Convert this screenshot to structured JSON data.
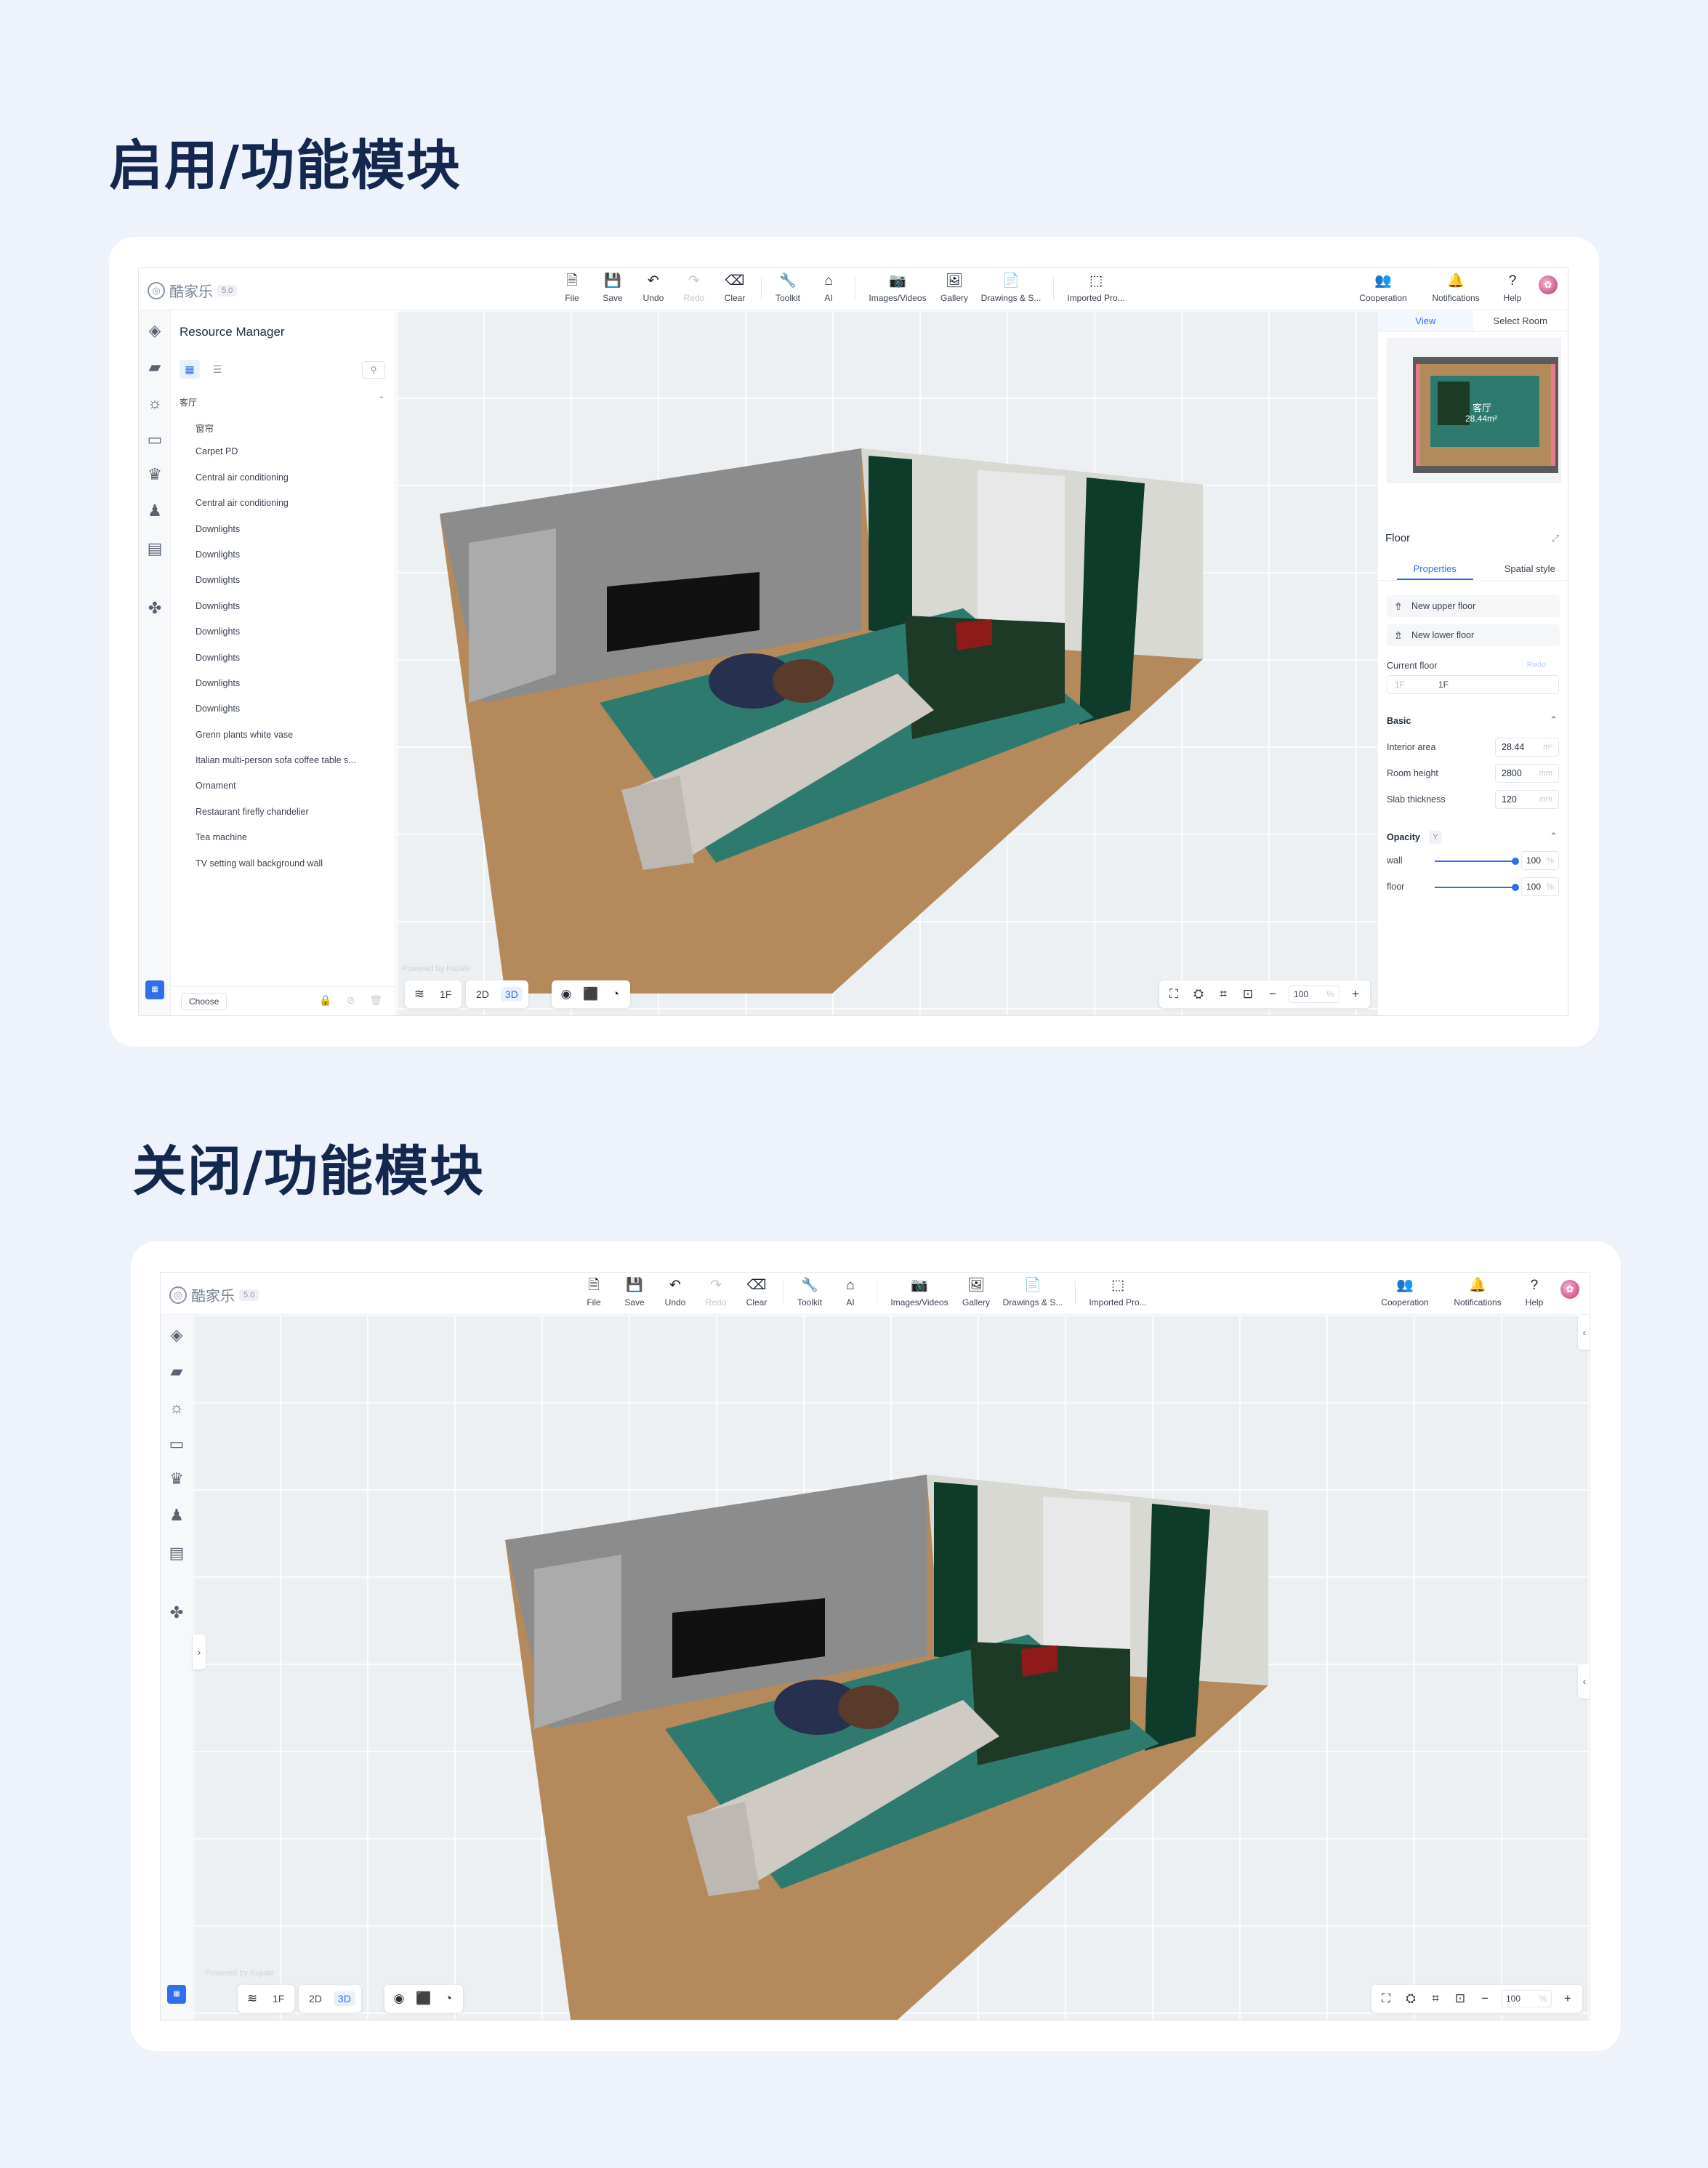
{
  "headings": {
    "enabled": "启用/功能模块",
    "disabled": "关闭/功能模块"
  },
  "app": {
    "logo_text": "酷家乐",
    "version": "5.0",
    "powered": "Powered by Kujiale"
  },
  "toolbar": {
    "file": "File",
    "save": "Save",
    "undo": "Undo",
    "redo": "Redo",
    "clear": "Clear",
    "toolkit": "Toolkit",
    "ai": "AI",
    "images_videos": "Images/Videos",
    "gallery": "Gallery",
    "drawings": "Drawings & S...",
    "imported": "Imported Pro...",
    "cooperation": "Cooperation",
    "notifications": "Notifications",
    "help": "Help"
  },
  "resource_manager": {
    "title": "Resource Manager",
    "group": "客厅",
    "items": [
      "窗帘",
      "Carpet PD",
      "Central air conditioning",
      "Central air conditioning",
      "Downlights",
      "Downlights",
      "Downlights",
      "Downlights",
      "Downlights",
      "Downlights",
      "Downlights",
      "Downlights",
      "Grenn plants white vase",
      "Italian multi-person sofa coffee table s...",
      "Ornament",
      "Restaurant firefly chandelier",
      "Tea machine",
      "TV setting wall background wall"
    ],
    "choose": "Choose"
  },
  "view_controls": {
    "floor": "1F",
    "mode_2d": "2D",
    "mode_3d": "3D",
    "zoom": "100",
    "zoom_unit": "%"
  },
  "right_panel": {
    "tab_view": "View",
    "tab_select_room": "Select Room",
    "minimap_label_1": "客厅",
    "minimap_label_2": "28.44m²",
    "section": "Floor",
    "sub_properties": "Properties",
    "sub_spatial": "Spatial style",
    "new_upper": "New upper floor",
    "new_lower": "New lower floor",
    "current_floor_label": "Current floor",
    "redo_link": "Redo",
    "current_floor_a": "1F",
    "current_floor_b": "1F",
    "basic": "Basic",
    "interior_area_label": "Interior area",
    "interior_area_value": "28.44",
    "interior_area_unit": "m²",
    "room_height_label": "Room height",
    "room_height_value": "2800",
    "room_height_unit": "mm",
    "slab_label": "Slab thickness",
    "slab_value": "120",
    "slab_unit": "mm",
    "opacity": "Opacity",
    "opacity_tag": "Y",
    "wall_label": "wall",
    "wall_value": "100",
    "floor_label": "floor",
    "floor_value": "100",
    "pct": "%"
  },
  "colors": {
    "accent": "#2f6fed",
    "heading": "#14274e",
    "background": "#eef2fb",
    "curtain": "#0f3b2b",
    "rug": "#2f7a6e",
    "sofa": "#cfcac4",
    "floor_wood": "#b48a5c"
  }
}
